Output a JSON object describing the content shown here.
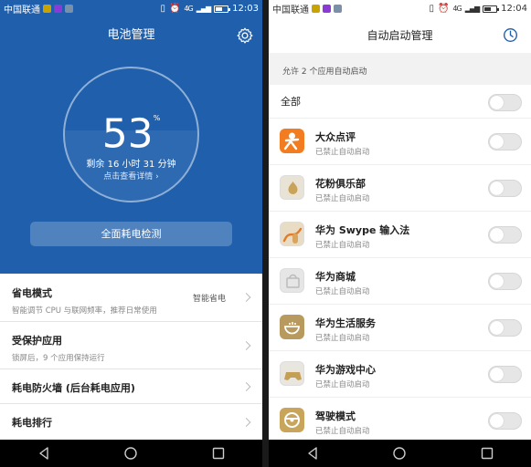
{
  "left": {
    "status": {
      "carrier": "中国联通",
      "network": "4G",
      "time": "12:03",
      "battery_level": 0.53
    },
    "title": "电池管理",
    "battery": {
      "percent": "53",
      "percent_symbol": "%",
      "remaining": "剩余 16 小时 31 分钟",
      "detail_link": "点击查看详情 ›"
    },
    "check_button": "全面耗电检测",
    "menu": [
      {
        "title": "省电模式",
        "subtitle": "智能调节 CPU 与联网频率，推荐日常使用",
        "value": "智能省电"
      },
      {
        "title": "受保护应用",
        "subtitle": "锁屏后，9 个应用保持运行",
        "value": ""
      },
      {
        "title": "耗电防火墙 (后台耗电应用)",
        "subtitle": "",
        "value": ""
      },
      {
        "title": "耗电排行",
        "subtitle": "",
        "value": ""
      }
    ]
  },
  "right": {
    "status": {
      "carrier": "中国联通",
      "network": "4G",
      "time": "12:04",
      "battery_level": 0.53
    },
    "title": "自动启动管理",
    "allow_text": "允许 2 个应用自动启动",
    "all_label": "全部",
    "apps": [
      {
        "name": "大众点评",
        "status": "已禁止自动启动",
        "icon": "dianping-icon",
        "color": "#f47c20"
      },
      {
        "name": "花粉俱乐部",
        "status": "已禁止自动启动",
        "icon": "huafen-icon",
        "color": "#e9e3d6"
      },
      {
        "name": "华为 Swype 输入法",
        "status": "已禁止自动启动",
        "icon": "swype-icon",
        "color": "#e8dcc4"
      },
      {
        "name": "华为商城",
        "status": "已禁止自动启动",
        "icon": "vmall-icon",
        "color": "#e6e6e6"
      },
      {
        "name": "华为生活服务",
        "status": "已禁止自动启动",
        "icon": "life-service-icon",
        "color": "#b89a5e"
      },
      {
        "name": "华为游戏中心",
        "status": "已禁止自动启动",
        "icon": "game-center-icon",
        "color": "#e9e6df"
      },
      {
        "name": "驾驶模式",
        "status": "已禁止自动启动",
        "icon": "drive-mode-icon",
        "color": "#c9a55c"
      }
    ]
  },
  "colors": {
    "header_blue": "#1f5fac",
    "toggle_off": "#e6e6e6"
  }
}
